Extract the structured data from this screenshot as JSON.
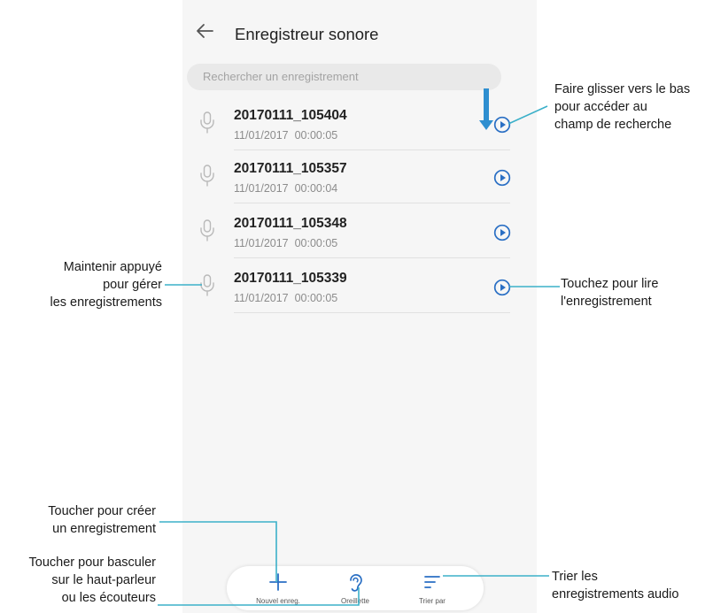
{
  "app": {
    "title": "Enregistreur sonore",
    "search_placeholder": "Rechercher un enregistrement"
  },
  "recordings": [
    {
      "name": "20170111_105404",
      "date": "11/01/2017",
      "duration": "00:00:05"
    },
    {
      "name": "20170111_105357",
      "date": "11/01/2017",
      "duration": "00:00:04"
    },
    {
      "name": "20170111_105348",
      "date": "11/01/2017",
      "duration": "00:00:05"
    },
    {
      "name": "20170111_105339",
      "date": "11/01/2017",
      "duration": "00:00:05"
    }
  ],
  "bottom_bar": {
    "new_label": "Nouvel enreg.",
    "earpiece_label": "Oreillette",
    "sort_label": "Trier par"
  },
  "annotations": {
    "swipe": [
      "Faire glisser vers le bas",
      "pour accéder au",
      "champ de recherche"
    ],
    "hold": [
      "Maintenir appuyé",
      "pour gérer",
      "les enregistrements"
    ],
    "play": [
      "Touchez pour lire",
      "l'enregistrement"
    ],
    "create": [
      "Toucher pour créer",
      "un enregistrement"
    ],
    "toggle": [
      "Toucher pour basculer",
      "sur le haut-parleur",
      "ou les écouteurs"
    ],
    "sort": [
      "Trier les",
      "enregistrements audio"
    ]
  },
  "colors": {
    "accent": "#2a6fc4",
    "annotation_line": "#3bb0c9",
    "swipe_arrow": "#2f8fd0"
  }
}
